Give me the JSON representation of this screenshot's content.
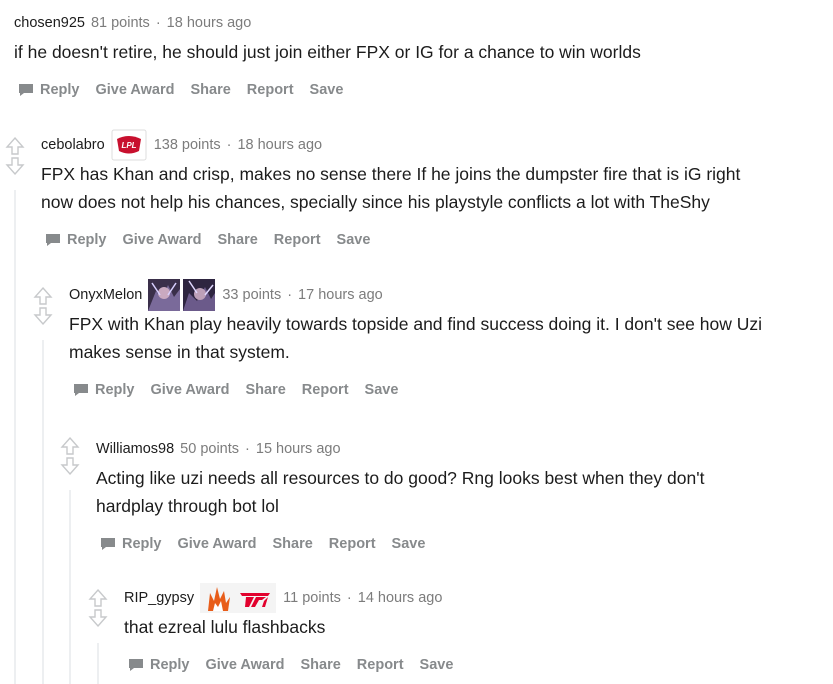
{
  "actions": {
    "reply": "Reply",
    "give_award": "Give Award",
    "share": "Share",
    "report": "Report",
    "save": "Save"
  },
  "comments": [
    {
      "author": "chosen925",
      "points": "81 points",
      "time": "18 hours ago",
      "body": "if he doesn't retire, he should just join either FPX or IG for a chance to win worlds",
      "flairs": []
    },
    {
      "author": "cebolabro",
      "points": "138 points",
      "time": "18 hours ago",
      "body": "FPX has Khan and crisp, makes no sense there If he joins the dumpster fire that is iG right\nnow does not help his chances, specially since his playstyle conflicts a lot with TheShy",
      "flairs": [
        "lpl-logo-flair"
      ],
      "flair_text": "LPL"
    },
    {
      "author": "OnyxMelon",
      "points": "33 points",
      "time": "17 hours ago",
      "body": "FPX with Khan play heavily towards topside and find success doing it. I don't see how Uzi\nmakes sense in that system.",
      "flairs": [
        "champion-portrait-flair",
        "champion-portrait-flair"
      ]
    },
    {
      "author": "Williamos98",
      "points": "50 points",
      "time": "15 hours ago",
      "body": "Acting like uzi needs all resources to do good? Rng looks best when they don't\nhardplay through bot lol",
      "flairs": []
    },
    {
      "author": "RIP_gypsy",
      "points": "11 points",
      "time": "14 hours ago",
      "body": "that ezreal lulu flashbacks",
      "flairs": [
        "rng-logo-flair",
        "skt-logo-flair"
      ]
    }
  ],
  "colors": {
    "meta_gray": "#7c7c7c",
    "action_gray": "#878a8c",
    "text": "#1c1c1c",
    "lpl_red": "#c8102e",
    "rng_orange": "#e85d1a",
    "skt_red": "#e2012d"
  }
}
